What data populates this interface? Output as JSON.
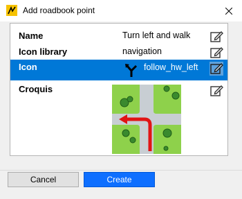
{
  "window": {
    "title": "Add roadbook point",
    "app_icon": "roadbook-app-icon",
    "close_icon": "close-icon"
  },
  "properties": [
    {
      "label": "Name",
      "value": "Turn left and walk",
      "selected": false
    },
    {
      "label": "Icon library",
      "value": "navigation",
      "selected": false
    },
    {
      "label": "Icon",
      "value": "follow_hw_left",
      "selected": true
    },
    {
      "label": "Croquis",
      "value": "",
      "selected": false
    }
  ],
  "icons": {
    "edit": "edit-pencil-icon",
    "icon_preview": "follow-highway-left-icon",
    "croquis_preview": "intersection-left-turn-sketch"
  },
  "buttons": {
    "cancel_label": "Cancel",
    "create_label": "Create"
  },
  "colors": {
    "selection": "#0078d7",
    "primary_button": "#0e6fff",
    "croquis_grass": "#8ed14b",
    "croquis_road": "#c8ced3",
    "croquis_arrow": "#e11414"
  }
}
